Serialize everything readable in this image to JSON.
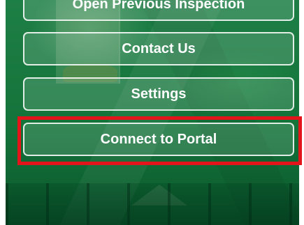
{
  "menu": {
    "items": [
      {
        "id": "open_previous",
        "label": "Open Previous Inspection"
      },
      {
        "id": "contact",
        "label": "Contact Us"
      },
      {
        "id": "settings",
        "label": "Settings"
      },
      {
        "id": "portal",
        "label": "Connect to Portal"
      }
    ]
  },
  "annotation": {
    "highlight_color": "#e4141b",
    "highlighted_item": "Connect to Portal"
  },
  "colors": {
    "background_green": "#12783c",
    "button_border": "#ffffff",
    "button_text": "#ffffff"
  }
}
